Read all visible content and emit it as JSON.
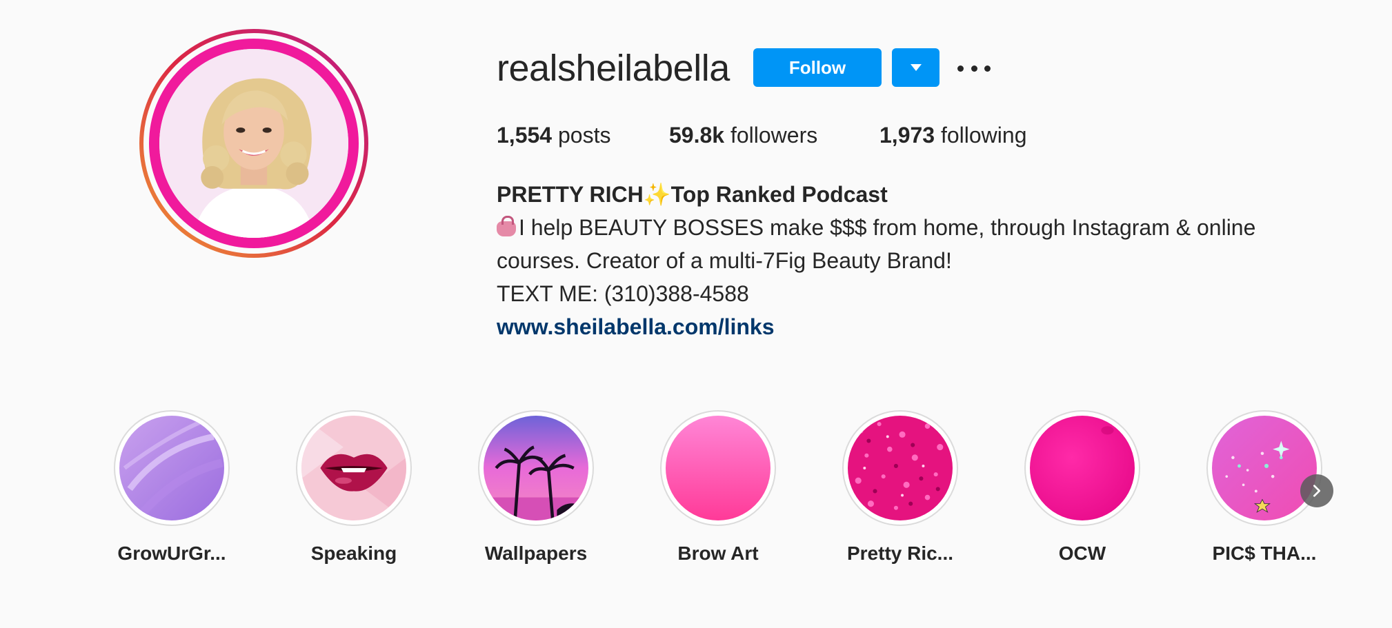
{
  "profile": {
    "username": "realsheilabella",
    "follow_label": "Follow",
    "avatar_alt": "profile photo"
  },
  "stats": {
    "posts_value": "1,554",
    "posts_label": "posts",
    "followers_value": "59.8k",
    "followers_label": "followers",
    "following_value": "1,973",
    "following_label": "following"
  },
  "bio": {
    "title_part1": "PRETTY RICH",
    "title_sparkle": "✨",
    "title_part2": "Top Ranked Podcast",
    "line1": "I help BEAUTY BOSSES make $$$ from home, through Instagram & online",
    "line2": "courses. Creator of a multi-7Fig Beauty Brand!",
    "line3": "TEXT ME: (310)388-4588",
    "link": "www.sheilabella.com/links"
  },
  "highlights": [
    {
      "label": "GrowUrGr..."
    },
    {
      "label": "Speaking"
    },
    {
      "label": "Wallpapers"
    },
    {
      "label": "Brow Art"
    },
    {
      "label": "Pretty Ric..."
    },
    {
      "label": "OCW"
    },
    {
      "label": "PIC$ THA..."
    }
  ],
  "colors": {
    "accent": "#0095f6",
    "link": "#00376b",
    "avatar_border": "#f01a9c"
  },
  "icons": {
    "more": "more-options-icon",
    "dropdown": "chevron-down-icon",
    "next": "chevron-right-icon"
  }
}
